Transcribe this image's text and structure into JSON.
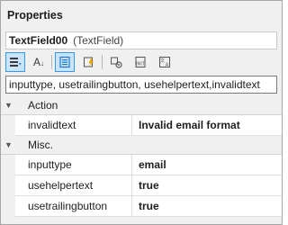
{
  "panel": {
    "title": "Properties"
  },
  "object_selector": {
    "name": "TextField00",
    "type": "(TextField)"
  },
  "toolbar": {
    "buttons": [
      {
        "icon": "categorized-icon",
        "active": true
      },
      {
        "icon": "alphabetical-icon",
        "active": false
      },
      {
        "icon": "properties-icon",
        "active": true
      },
      {
        "icon": "events-icon",
        "active": false
      },
      {
        "icon": "behaviors-icon",
        "active": false
      },
      {
        "icon": "init-icon",
        "active": false
      },
      {
        "icon": "localize-icon",
        "active": false
      }
    ]
  },
  "search": {
    "value": "inputtype, usetrailingbutton, usehelpertext,invalidtext"
  },
  "categories": [
    {
      "name": "Action",
      "expanded": true,
      "properties": [
        {
          "name": "invalidtext",
          "value": "Invalid email format"
        }
      ]
    },
    {
      "name": "Misc.",
      "expanded": true,
      "properties": [
        {
          "name": "inputtype",
          "value": "email"
        },
        {
          "name": "usehelpertext",
          "value": "true"
        },
        {
          "name": "usetrailingbutton",
          "value": "true"
        }
      ]
    }
  ],
  "colors": {
    "panel_bg": "#f0f0f0",
    "active_button_bg": "#cce4f7",
    "active_button_border": "#3399ff"
  }
}
